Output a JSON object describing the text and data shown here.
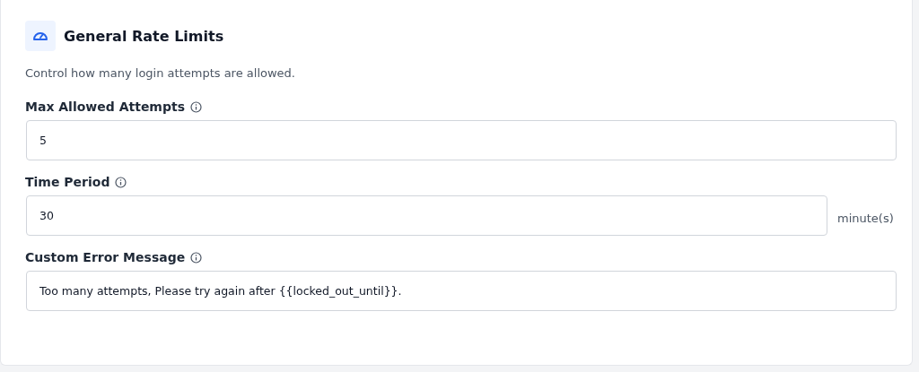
{
  "section": {
    "title": "General Rate Limits",
    "description": "Control how many login attempts are allowed."
  },
  "fields": [
    {
      "label": "Max Allowed Attempts",
      "value": "5"
    },
    {
      "label": "Time Period",
      "value": "30",
      "suffix": "minute(s)"
    },
    {
      "label": "Custom Error Message",
      "value": "Too many attempts, Please try again after {{locked_out_until}}."
    }
  ]
}
